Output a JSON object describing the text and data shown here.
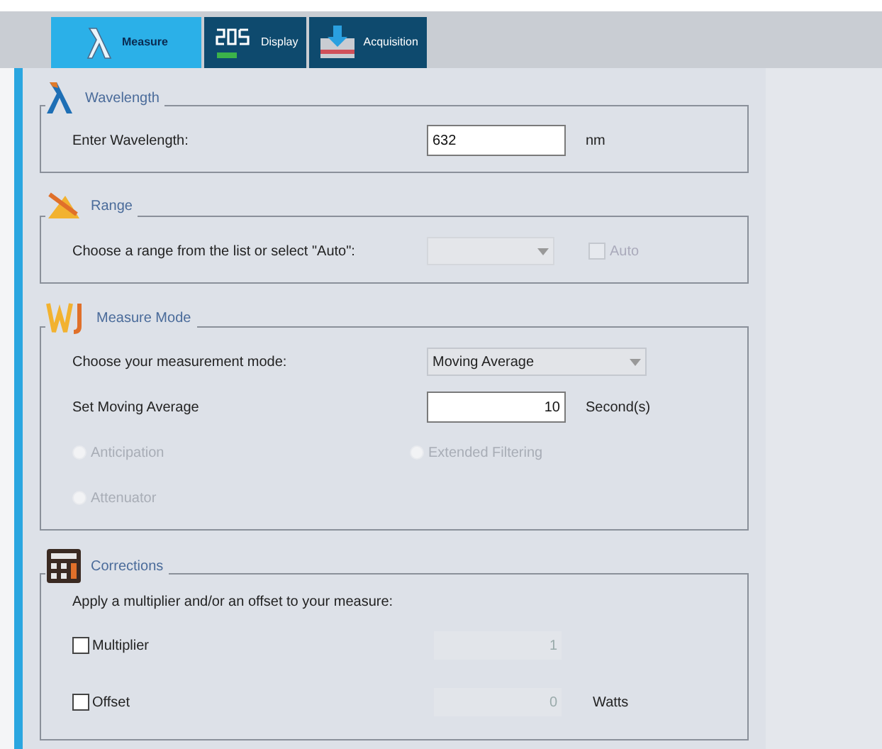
{
  "tabs": [
    {
      "label": "Measure",
      "selected": true
    },
    {
      "label": "Display",
      "selected": false
    },
    {
      "label": "Acquisition",
      "selected": false
    }
  ],
  "sections": [
    {
      "title": "Wavelength",
      "rows": [
        {
          "kind": "input",
          "label": "Enter Wavelength:",
          "value": "632",
          "unit": "nm",
          "disabled": false
        }
      ]
    },
    {
      "title": "Range",
      "rows": [
        {
          "kind": "select",
          "label": "Choose a range from the list or select \"Auto\":",
          "value": "",
          "disabled": true,
          "check": {
            "label": "Auto",
            "checked": false,
            "disabled": true
          }
        }
      ]
    },
    {
      "title": "Measure Mode",
      "rows": [
        {
          "kind": "select",
          "label": "Choose your measurement mode:",
          "value": "Moving Average",
          "disabled": false
        },
        {
          "kind": "number",
          "label": "Set Moving Average",
          "value": "10",
          "unit": "Second(s)",
          "disabled": false
        },
        {
          "kind": "radios",
          "items": [
            {
              "label": "Anticipation",
              "selected": false,
              "disabled": true
            },
            {
              "label": "Extended Filtering",
              "selected": false,
              "disabled": true
            }
          ]
        },
        {
          "kind": "radios",
          "items": [
            {
              "label": "Attenuator",
              "selected": false,
              "disabled": true
            }
          ]
        }
      ]
    },
    {
      "title": "Corrections",
      "rows": [
        {
          "kind": "text",
          "label": "Apply a multiplier and/or an offset to your measure:"
        },
        {
          "kind": "checkinput",
          "label": "Multiplier",
          "checked": false,
          "value": "1",
          "disabled": true
        },
        {
          "kind": "checkinput",
          "label": "Offset",
          "checked": false,
          "value": "0",
          "disabled": true,
          "unit": "Watts"
        }
      ]
    }
  ]
}
